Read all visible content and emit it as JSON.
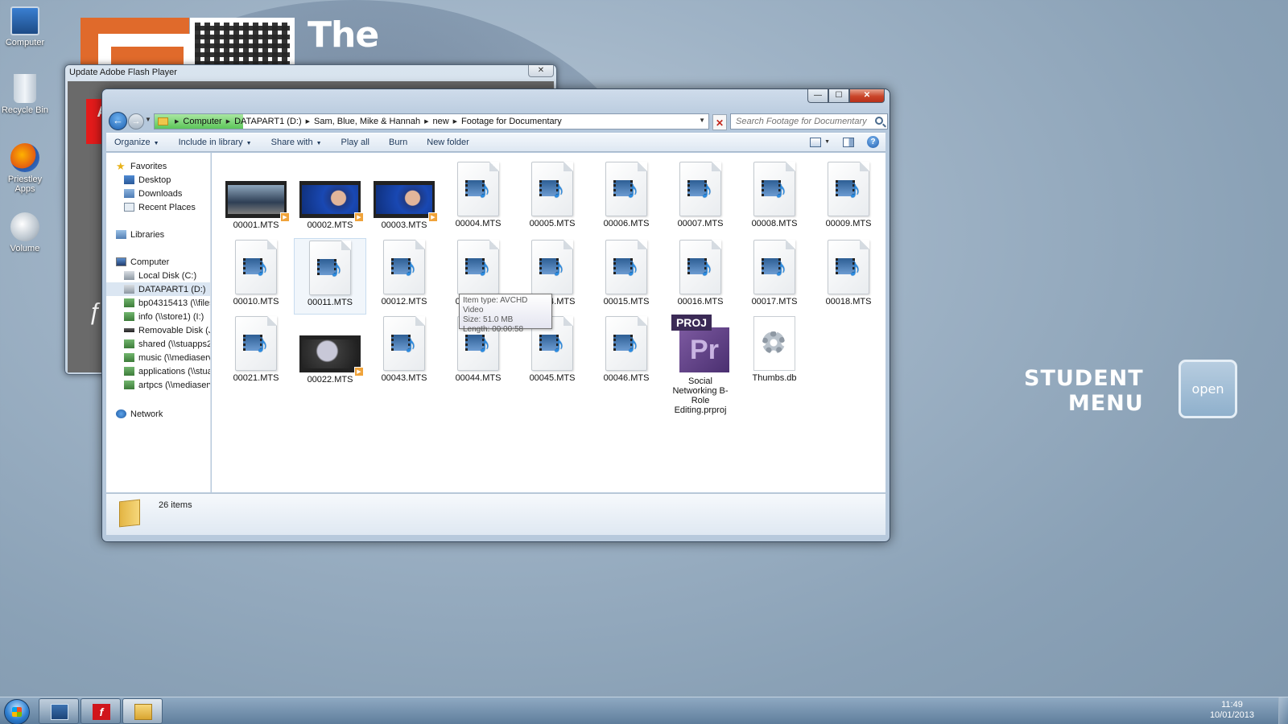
{
  "desktop": {
    "background_text": "The",
    "icons": [
      {
        "label": "Computer",
        "icon": "computer-icon"
      },
      {
        "label": "Recycle Bin",
        "icon": "recycle-bin-icon"
      },
      {
        "label": "Priestley Apps",
        "icon": "firefox-icon"
      },
      {
        "label": "Volume",
        "icon": "volume-icon"
      }
    ],
    "student_menu": {
      "line1": "STUDENT",
      "line2": "MENU",
      "button": "open"
    }
  },
  "flash_window": {
    "title": "Update Adobe Flash Player",
    "close": "✕"
  },
  "explorer": {
    "window_buttons": {
      "minimize": "—",
      "maximize": "☐",
      "close": "✕"
    },
    "breadcrumbs": [
      "Computer",
      "DATAPART1 (D:)",
      "Sam, Blue, Mike & Hannah",
      "new",
      "Footage for Documentary"
    ],
    "search_placeholder": "Search Footage for Documentary",
    "toolbar": {
      "organize": "Organize",
      "include_in_library": "Include in library",
      "share_with": "Share with",
      "play_all": "Play all",
      "burn": "Burn",
      "new_folder": "New folder"
    },
    "nav": {
      "favorites": "Favorites",
      "desktop": "Desktop",
      "downloads": "Downloads",
      "recent_places": "Recent Places",
      "libraries": "Libraries",
      "computer": "Computer",
      "local_disk": "Local Disk (C:)",
      "datapart": "DATAPART1 (D:)",
      "bp": "bp04315413 (\\\\filese",
      "info": "info (\\\\store1) (I:)",
      "removable": "Removable Disk (J:)",
      "shared": "shared (\\\\stuapps2\\",
      "music": "music (\\\\mediaserve",
      "applications": "applications (\\\\stuap",
      "artpcs": "artpcs (\\\\mediaserve",
      "network": "Network"
    },
    "files": [
      {
        "name": "00001.MTS",
        "icon": "video-thumbnail"
      },
      {
        "name": "00002.MTS",
        "icon": "video-thumbnail"
      },
      {
        "name": "00003.MTS",
        "icon": "video-thumbnail"
      },
      {
        "name": "00004.MTS",
        "icon": "avchd-file-icon"
      },
      {
        "name": "00005.MTS",
        "icon": "avchd-file-icon"
      },
      {
        "name": "00006.MTS",
        "icon": "avchd-file-icon"
      },
      {
        "name": "00007.MTS",
        "icon": "avchd-file-icon"
      },
      {
        "name": "00008.MTS",
        "icon": "avchd-file-icon"
      },
      {
        "name": "00009.MTS",
        "icon": "avchd-file-icon"
      },
      {
        "name": "00010.MTS",
        "icon": "avchd-file-icon"
      },
      {
        "name": "00011.MTS",
        "icon": "avchd-file-icon"
      },
      {
        "name": "00012.MTS",
        "icon": "avchd-file-icon"
      },
      {
        "name": "00013.MTS",
        "icon": "avchd-file-icon"
      },
      {
        "name": "00014.MTS",
        "icon": "avchd-file-icon"
      },
      {
        "name": "00015.MTS",
        "icon": "avchd-file-icon"
      },
      {
        "name": "00016.MTS",
        "icon": "avchd-file-icon"
      },
      {
        "name": "00017.MTS",
        "icon": "avchd-file-icon"
      },
      {
        "name": "00018.MTS",
        "icon": "avchd-file-icon"
      },
      {
        "name": "00021.MTS",
        "icon": "avchd-file-icon"
      },
      {
        "name": "00022.MTS",
        "icon": "video-thumbnail"
      },
      {
        "name": "00043.MTS",
        "icon": "avchd-file-icon"
      },
      {
        "name": "00044.MTS",
        "icon": "avchd-file-icon"
      },
      {
        "name": "00045.MTS",
        "icon": "avchd-file-icon"
      },
      {
        "name": "00046.MTS",
        "icon": "avchd-file-icon"
      },
      {
        "name": "Social Networking B-Role Editing.prproj",
        "icon": "premiere-project-icon",
        "badge": "PROJ",
        "app": "Pr"
      },
      {
        "name": "Thumbs.db",
        "icon": "settings-file-icon"
      }
    ],
    "tooltip": {
      "type": "Item type: AVCHD Video",
      "size": "Size: 51.0 MB",
      "length": "Length: 00:00:58"
    },
    "status": {
      "item_count": "26 items"
    }
  },
  "taskbar": {
    "time": "11:49",
    "date": "10/01/2013",
    "flash_glyph": "f"
  }
}
